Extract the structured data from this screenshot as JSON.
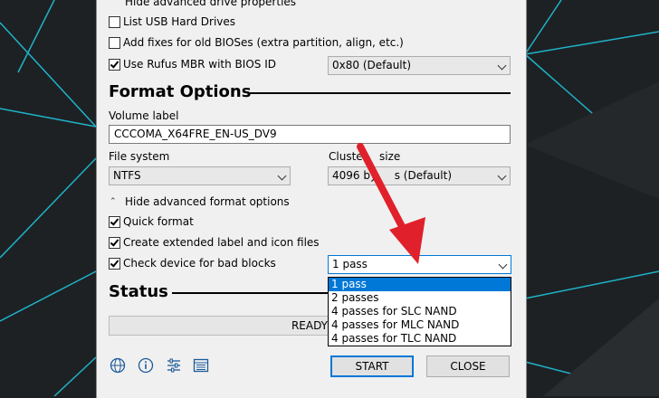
{
  "drive_props": {
    "toggle_label": "Hide advanced drive properties",
    "list_usb_label": "List USB Hard Drives",
    "list_usb_checked": false,
    "old_bios_label": "Add fixes for old BIOSes (extra partition, align, etc.)",
    "old_bios_checked": false,
    "rufus_mbr_label": "Use Rufus MBR with BIOS ID",
    "rufus_mbr_checked": true,
    "bios_id_value": "0x80 (Default)"
  },
  "format_options": {
    "heading": "Format Options",
    "volume_label_caption": "Volume label",
    "volume_label_value": "CCCOMA_X64FRE_EN-US_DV9",
    "file_system_caption": "File system",
    "file_system_value": "NTFS",
    "cluster_size_caption": "Cluste",
    "cluster_size_caption_end": "size",
    "cluster_size_value_start": "4096 by",
    "cluster_size_value_end": "s (Default)",
    "toggle_label": "Hide advanced format options",
    "quick_format_label": "Quick format",
    "quick_format_checked": true,
    "extended_label": "Create extended label and icon files",
    "extended_checked": true,
    "bad_blocks_label": "Check device for bad blocks",
    "bad_blocks_checked": true,
    "passes_value": "1 pass",
    "passes_options": [
      "1 pass",
      "2 passes",
      "4 passes for SLC NAND",
      "4 passes for MLC NAND",
      "4 passes for TLC NAND"
    ],
    "passes_selected": 0
  },
  "status": {
    "heading": "Status",
    "progress_text": "READY"
  },
  "buttons": {
    "start_label": "START",
    "close_label": "CLOSE"
  },
  "icons": [
    "globe-icon",
    "info-icon",
    "settings-sliders-icon",
    "log-icon"
  ],
  "colors": {
    "accent": "#0078d7",
    "arrow": "#e0202a"
  }
}
